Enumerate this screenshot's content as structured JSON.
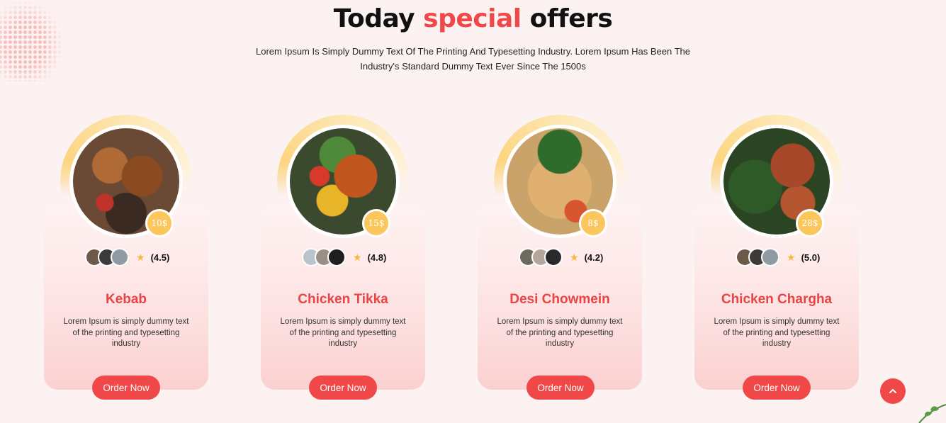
{
  "header": {
    "title_part1": "Today",
    "title_accent": "special",
    "title_part2": "offers",
    "subtitle": "Lorem Ipsum Is Simply Dummy Text Of The Printing And Typesetting Industry. Lorem Ipsum Has Been The Industry's Standard Dummy Text Ever Since The 1500s"
  },
  "colors": {
    "accent": "#f04848",
    "price_badge": "#fbc75d",
    "star": "#f7b93c",
    "background": "#fdf2f2"
  },
  "cards": [
    {
      "name": "Kebab",
      "price": "10$",
      "rating": "(4.5)",
      "description": "Lorem Ipsum is simply dummy text of the printing and typesetting industry",
      "order_label": "Order Now"
    },
    {
      "name": "Chicken Tikka",
      "price": "15$",
      "rating": "(4.8)",
      "description": "Lorem Ipsum is simply dummy text of the printing and typesetting industry",
      "order_label": "Order Now"
    },
    {
      "name": "Desi Chowmein",
      "price": "8$",
      "rating": "(4.2)",
      "description": "Lorem Ipsum is simply dummy text of the printing and typesetting industry",
      "order_label": "Order Now"
    },
    {
      "name": "Chicken Chargha",
      "price": "28$",
      "rating": "(5.0)",
      "description": "Lorem Ipsum is simply dummy text of the printing and typesetting industry",
      "order_label": "Order Now"
    }
  ],
  "scroll_top_icon": "chevron-up-icon",
  "star_icon": "star-icon"
}
